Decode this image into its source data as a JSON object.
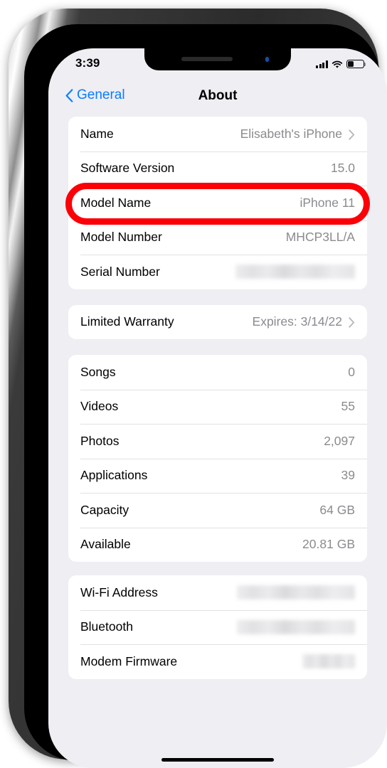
{
  "status_bar": {
    "time": "3:39",
    "signal_icon": "cellular-signal-icon",
    "wifi_icon": "wifi-icon",
    "battery_icon": "battery-icon",
    "battery_level_pct": 35
  },
  "nav": {
    "back_label": "General",
    "back_icon": "chevron-left-icon",
    "title": "About"
  },
  "colors": {
    "accent_blue": "#0a7cff",
    "annotation_red": "#fb0007",
    "value_grey": "#8b8b90",
    "page_background": "#eeeef3",
    "card_background": "#ffffff"
  },
  "annotation": {
    "shape": "ellipse",
    "color": "#fb0007",
    "targets_row": "Software Version"
  },
  "groups": [
    {
      "id": "device-info",
      "rows": [
        {
          "label": "Name",
          "value": "Elisabeth's iPhone",
          "chevron": true,
          "redacted": false
        },
        {
          "label": "Software Version",
          "value": "15.0",
          "chevron": false,
          "redacted": false,
          "highlighted": true
        },
        {
          "label": "Model Name",
          "value": "iPhone 11",
          "chevron": false,
          "redacted": false
        },
        {
          "label": "Model Number",
          "value": "MHCP3LL/A",
          "chevron": false,
          "redacted": false
        },
        {
          "label": "Serial Number",
          "value": "",
          "chevron": false,
          "redacted": true,
          "redacted_width": 168
        }
      ]
    },
    {
      "id": "warranty",
      "rows": [
        {
          "label": "Limited Warranty",
          "value": "Expires: 3/14/22",
          "chevron": true,
          "redacted": false
        }
      ]
    },
    {
      "id": "storage",
      "rows": [
        {
          "label": "Songs",
          "value": "0",
          "chevron": false,
          "redacted": false
        },
        {
          "label": "Videos",
          "value": "55",
          "chevron": false,
          "redacted": false
        },
        {
          "label": "Photos",
          "value": "2,097",
          "chevron": false,
          "redacted": false
        },
        {
          "label": "Applications",
          "value": "39",
          "chevron": false,
          "redacted": false
        },
        {
          "label": "Capacity",
          "value": "64 GB",
          "chevron": false,
          "redacted": false
        },
        {
          "label": "Available",
          "value": "20.81 GB",
          "chevron": false,
          "redacted": false
        }
      ]
    },
    {
      "id": "network",
      "rows": [
        {
          "label": "Wi-Fi Address",
          "value": "",
          "chevron": false,
          "redacted": true,
          "redacted_width": 166
        },
        {
          "label": "Bluetooth",
          "value": "",
          "chevron": false,
          "redacted": true,
          "redacted_width": 166
        },
        {
          "label": "Modem Firmware",
          "value": "",
          "chevron": false,
          "redacted": true,
          "redacted_width": 74
        }
      ]
    }
  ]
}
